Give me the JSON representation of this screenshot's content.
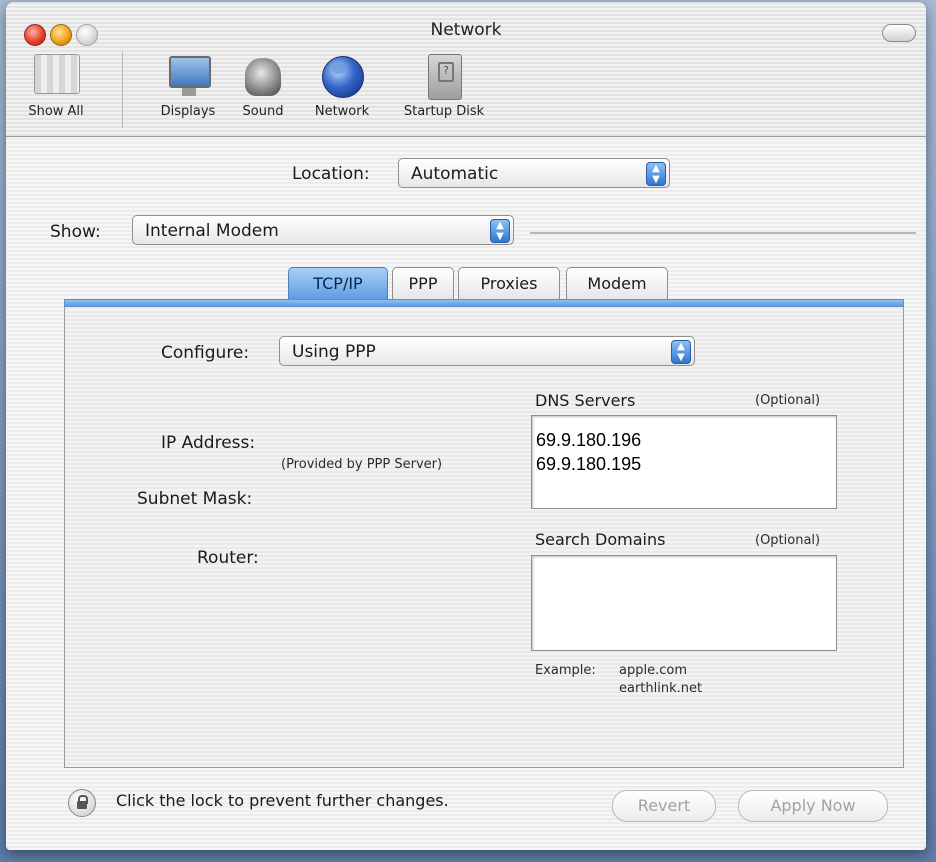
{
  "window": {
    "title": "Network"
  },
  "toolbar": {
    "items": [
      {
        "label": "Show All",
        "icon": "show-all-icon"
      },
      {
        "label": "Displays",
        "icon": "displays-icon"
      },
      {
        "label": "Sound",
        "icon": "sound-icon"
      },
      {
        "label": "Network",
        "icon": "network-globe-icon"
      },
      {
        "label": "Startup Disk",
        "icon": "startup-disk-icon"
      }
    ]
  },
  "location": {
    "label": "Location:",
    "value": "Automatic"
  },
  "show": {
    "label": "Show:",
    "value": "Internal Modem"
  },
  "tabs": [
    {
      "label": "TCP/IP",
      "active": true
    },
    {
      "label": "PPP",
      "active": false
    },
    {
      "label": "Proxies",
      "active": false
    },
    {
      "label": "Modem",
      "active": false
    }
  ],
  "tcpip": {
    "configure_label": "Configure:",
    "configure_value": "Using PPP",
    "ip_label": "IP Address:",
    "provided_note": "(Provided by PPP Server)",
    "subnet_label": "Subnet Mask:",
    "router_label": "Router:",
    "dns_label": "DNS Servers",
    "dns_optional": "(Optional)",
    "dns_servers": [
      "69.9.180.196",
      "69.9.180.195"
    ],
    "search_label": "Search Domains",
    "search_optional": "(Optional)",
    "search_domains": [],
    "example_label": "Example:",
    "example_values": [
      "apple.com",
      "earthlink.net"
    ]
  },
  "footer": {
    "lock_text": "Click the lock to prevent further changes.",
    "revert_label": "Revert",
    "apply_label": "Apply Now"
  },
  "colors": {
    "accent_blue": "#5f9be0",
    "close": "#e4402c",
    "minimize": "#f0a21c"
  }
}
